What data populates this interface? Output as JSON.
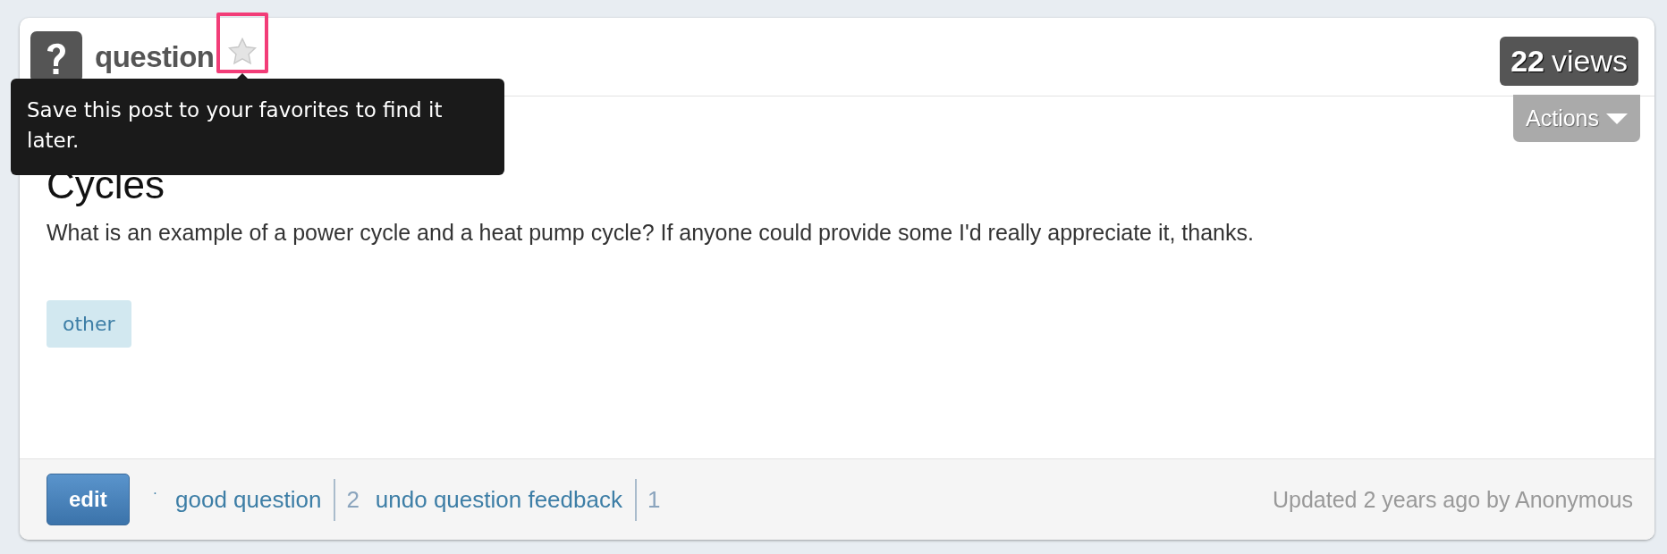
{
  "post": {
    "type_label": "question",
    "favorite": {
      "selected": false,
      "highlighted": true
    },
    "tooltip": "Save this post to your favorites to find it later.",
    "views": {
      "count": "22",
      "label": "views"
    },
    "actions": "Actions",
    "title": "Cycles",
    "body": "What is an example of a power cycle and a heat pump cycle? If anyone could provide some I'd really appreciate it, thanks.",
    "tags": [
      "other"
    ]
  },
  "footer": {
    "edit": "edit",
    "separator": "·",
    "feedback": [
      {
        "label": "good question",
        "count": "2"
      },
      {
        "label": "undo question feedback",
        "count": "1"
      }
    ],
    "updated": "Updated 2 years ago by Anonymous"
  }
}
